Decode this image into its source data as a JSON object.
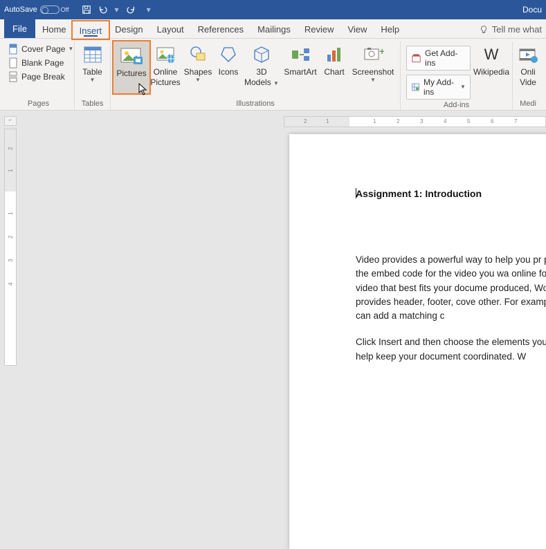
{
  "titlebar": {
    "autosave_label": "AutoSave",
    "autosave_state": "Off",
    "doc_title": "Docu"
  },
  "tabs": {
    "file": "File",
    "home": "Home",
    "insert": "Insert",
    "design": "Design",
    "layout": "Layout",
    "references": "References",
    "mailings": "Mailings",
    "review": "Review",
    "view": "View",
    "help": "Help",
    "tell_me": "Tell me what"
  },
  "ribbon": {
    "pages": {
      "cover_page": "Cover Page",
      "blank_page": "Blank Page",
      "page_break": "Page Break",
      "group": "Pages"
    },
    "tables": {
      "table": "Table",
      "group": "Tables"
    },
    "illustrations": {
      "pictures": "Pictures",
      "online_pictures_l1": "Online",
      "online_pictures_l2": "Pictures",
      "shapes": "Shapes",
      "icons": "Icons",
      "models_l1": "3D",
      "models_l2": "Models",
      "smartart": "SmartArt",
      "chart": "Chart",
      "screenshot": "Screenshot",
      "group": "Illustrations"
    },
    "addins": {
      "get": "Get Add-ins",
      "my": "My Add-ins",
      "wikipedia": "Wikipedia",
      "group": "Add-ins"
    },
    "media": {
      "online_video_l1": "Onli",
      "online_video_l2": "Vide",
      "group": "Medi"
    }
  },
  "ruler": {
    "h_ticks": [
      "2",
      "1",
      "1",
      "2",
      "3",
      "4",
      "5",
      "6",
      "7"
    ],
    "v_ticks": [
      "2",
      "1",
      "1",
      "2",
      "3",
      "4"
    ]
  },
  "document": {
    "heading": "Assignment 1: Introduction",
    "para1": "Video provides a powerful way to help you pr paste in the embed code for the video you wa online for the video that best fits your docume produced, Word provides header, footer, cove other. For example, you can add a matching c",
    "para2": "Click Insert and then choose the elements you also help keep your document coordinated. W"
  },
  "highlight": {
    "tab": "insert",
    "button": "pictures"
  }
}
